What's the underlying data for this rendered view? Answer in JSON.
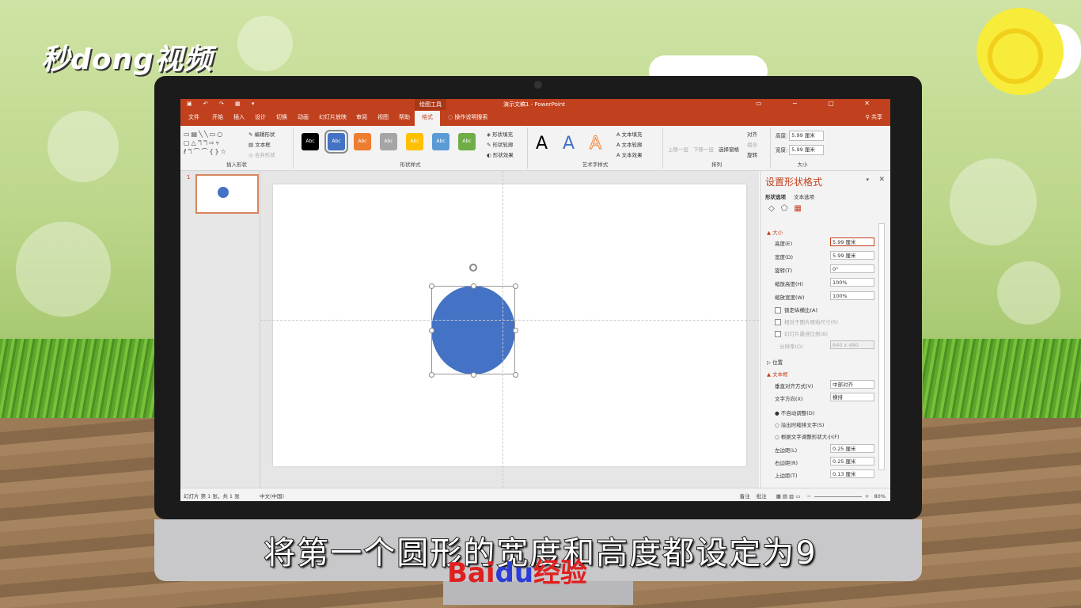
{
  "watermark_logo": "秒dong视频",
  "subtitle": "将第一个圆形的宽度和高度都设定为9",
  "baidu_logo": {
    "bai": "Bai",
    "du": "du",
    "jingyan": "经验"
  },
  "window": {
    "title": "演示文稿1 - PowerPoint",
    "context_tab": "绘图工具",
    "share": "共享",
    "quick_access_icons": [
      "save-icon",
      "undo-icon",
      "redo-icon",
      "present-icon"
    ]
  },
  "tabs": [
    "文件",
    "开始",
    "插入",
    "设计",
    "切换",
    "动画",
    "幻灯片放映",
    "审阅",
    "视图",
    "帮助",
    "格式"
  ],
  "active_tab": "格式",
  "tell_me": "操作说明搜索",
  "ribbon": {
    "insert_shapes": {
      "label": "插入形状",
      "edit_shape": "编辑形状",
      "text_box": "文本框",
      "merge_shapes": "合并形状"
    },
    "shape_styles": {
      "label": "形状样式",
      "swatches": [
        {
          "text": "Abc",
          "color": "#000000"
        },
        {
          "text": "Abc",
          "color": "#4472c4"
        },
        {
          "text": "Abc",
          "color": "#ed7d31"
        },
        {
          "text": "Abc",
          "color": "#a5a5a5"
        },
        {
          "text": "Abc",
          "color": "#ffc000"
        },
        {
          "text": "Abc",
          "color": "#5b9bd5"
        },
        {
          "text": "Abc",
          "color": "#70ad47"
        }
      ],
      "fill": "形状填充",
      "outline": "形状轮廓",
      "effects": "形状效果"
    },
    "wordart": {
      "label": "艺术字样式",
      "samples": [
        "A",
        "A",
        "A"
      ],
      "text_fill": "文本填充",
      "text_outline": "文本轮廓",
      "text_effects": "文本效果"
    },
    "arrange": {
      "label": "排列",
      "bring_forward": "上移一层",
      "send_backward": "下移一层",
      "selection_pane": "选择窗格",
      "align": "对齐",
      "group": "组合",
      "rotate": "旋转"
    },
    "size": {
      "label": "大小",
      "height_label": "高度:",
      "height_value": "5.99 厘米",
      "width_label": "宽度:",
      "width_value": "5.99 厘米"
    }
  },
  "slides_panel": {
    "slide_number": "1"
  },
  "format_pane": {
    "title": "设置形状格式",
    "tabs": [
      "形状选项",
      "文本选项"
    ],
    "section_size": "大小",
    "height_label": "高度(E)",
    "height_value": "5.99 厘米",
    "width_label": "宽度(D)",
    "width_value": "5.99 厘米",
    "rotation_label": "旋转(T)",
    "rotation_value": "0°",
    "scale_h_label": "缩放高度(H)",
    "scale_h_value": "100%",
    "scale_w_label": "缩放宽度(W)",
    "scale_w_value": "100%",
    "lock_aspect": "锁定纵横比(A)",
    "relative_original": "相对于图片原始尺寸(R)",
    "best_scale": "幻灯片最佳比例(B)",
    "resolution_label": "分辨率(O)",
    "resolution_value": "640 x 480",
    "section_position": "位置",
    "section_textbox": "文本框",
    "valign_label": "垂直对齐方式(V)",
    "valign_value": "中部对齐",
    "text_dir_label": "文字方向(X)",
    "text_dir_value": "横排",
    "no_autofit": "不自动调整(D)",
    "shrink_overflow": "溢出时缩排文字(S)",
    "resize_shape": "根据文字调整形状大小(F)",
    "left_margin_label": "左边距(L)",
    "left_margin_value": "0.25 厘米",
    "right_margin_label": "右边距(R)",
    "right_margin_value": "0.25 厘米",
    "top_margin_label": "上边距(T)",
    "top_margin_value": "0.13 厘米"
  },
  "status_bar": {
    "slide_info": "幻灯片 第 1 张，共 1 张",
    "language": "中文(中国)",
    "notes": "备注",
    "comments": "批注",
    "zoom": "80%"
  },
  "shape_color": "#4472c4",
  "accent_color": "#c1411e"
}
